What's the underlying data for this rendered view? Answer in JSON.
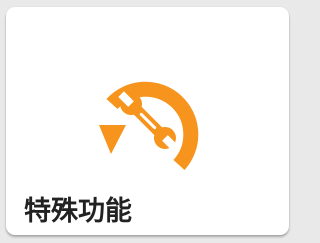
{
  "tile": {
    "label": "特殊功能",
    "icon": "wrench-restore-icon",
    "accent_color": "#f7941d"
  }
}
